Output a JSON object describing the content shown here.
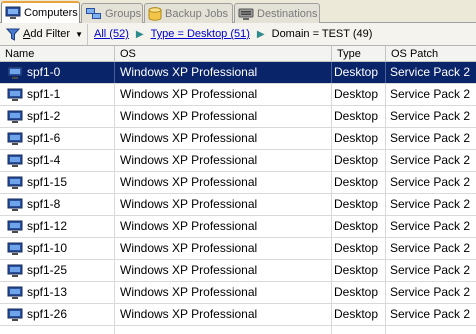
{
  "tabs": [
    {
      "label": "Computers",
      "icon": "computer-icon",
      "active": true
    },
    {
      "label": "Groups",
      "icon": "groups-icon",
      "active": false
    },
    {
      "label": "Backup Jobs",
      "icon": "database-icon",
      "active": false
    },
    {
      "label": "Destinations",
      "icon": "destinations-icon",
      "active": false
    }
  ],
  "filterbar": {
    "add_filter_label": "Add Filter",
    "add_filter_accel": "A",
    "add_filter_rest": "dd Filter",
    "crumbs": [
      {
        "label": "All (52)",
        "link": true
      },
      {
        "label": "Type = Desktop (51)",
        "link": true
      },
      {
        "label": "Domain = TEST (49)",
        "link": false
      }
    ]
  },
  "columns": {
    "name": "Name",
    "os": "OS",
    "type": "Type",
    "patch": "OS Patch"
  },
  "rows": [
    {
      "name": "spf1-0",
      "os": "Windows XP Professional",
      "type": "Desktop",
      "patch": "Service Pack 2",
      "selected": true
    },
    {
      "name": "spf1-1",
      "os": "Windows XP Professional",
      "type": "Desktop",
      "patch": "Service Pack 2"
    },
    {
      "name": "spf1-2",
      "os": "Windows XP Professional",
      "type": "Desktop",
      "patch": "Service Pack 2"
    },
    {
      "name": "spf1-6",
      "os": "Windows XP Professional",
      "type": "Desktop",
      "patch": "Service Pack 2"
    },
    {
      "name": "spf1-4",
      "os": "Windows XP Professional",
      "type": "Desktop",
      "patch": "Service Pack 2"
    },
    {
      "name": "spf1-15",
      "os": "Windows XP Professional",
      "type": "Desktop",
      "patch": "Service Pack 2"
    },
    {
      "name": "spf1-8",
      "os": "Windows XP Professional",
      "type": "Desktop",
      "patch": "Service Pack 2"
    },
    {
      "name": "spf1-12",
      "os": "Windows XP Professional",
      "type": "Desktop",
      "patch": "Service Pack 2"
    },
    {
      "name": "spf1-10",
      "os": "Windows XP Professional",
      "type": "Desktop",
      "patch": "Service Pack 2"
    },
    {
      "name": "spf1-25",
      "os": "Windows XP Professional",
      "type": "Desktop",
      "patch": "Service Pack 2"
    },
    {
      "name": "spf1-13",
      "os": "Windows XP Professional",
      "type": "Desktop",
      "patch": "Service Pack 2"
    },
    {
      "name": "spf1-26",
      "os": "Windows XP Professional",
      "type": "Desktop",
      "patch": "Service Pack 2"
    },
    {
      "name": "",
      "os": "",
      "type": "",
      "patch": ""
    }
  ],
  "colors": {
    "selection": "#0a246a",
    "accent_tab": "#e8a33d",
    "link": "#0000cc"
  }
}
